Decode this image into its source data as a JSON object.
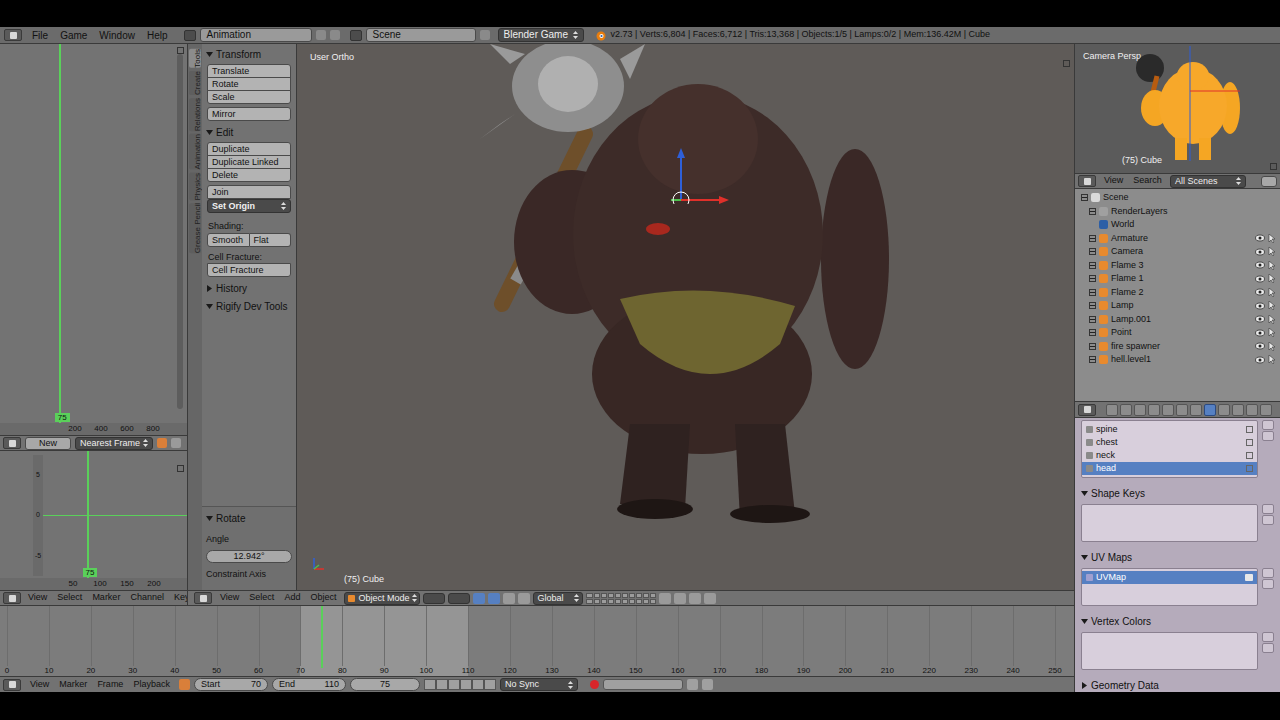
{
  "topbar": {
    "menus": [
      "File",
      "Game",
      "Window",
      "Help"
    ],
    "layout": "Animation",
    "scene": "Scene",
    "engine": "Blender Game",
    "stats": "v2.73 | Verts:6,804 | Faces:6,712 | Tris:13,368 | Objects:1/5 | Lamps:0/2 | Mem:136.42M | Cube"
  },
  "dopesheet_graph": {
    "frame": "75",
    "ticks": [
      "200",
      "400",
      "600",
      "800"
    ]
  },
  "graph_header": {
    "new_button": "New",
    "interpolation": "Nearest Frame"
  },
  "curve_graph": {
    "frame": "75",
    "ticks": [
      "50",
      "100",
      "150",
      "200"
    ],
    "value_ticks": [
      "5",
      "0",
      "-5"
    ]
  },
  "curve_header": {
    "menus": [
      "View",
      "Select",
      "Marker",
      "Channel",
      "Key"
    ]
  },
  "tool_tabs": [
    {
      "label": "Tools",
      "selected": true
    },
    {
      "label": "Create",
      "selected": false
    },
    {
      "label": "Relations",
      "selected": false
    },
    {
      "label": "Animation",
      "selected": false
    },
    {
      "label": "Physics",
      "selected": false
    },
    {
      "label": "Grease Pencil",
      "selected": false
    }
  ],
  "tool_panels": [
    {
      "title": "Transform",
      "expanded": true,
      "groups": [
        [
          {
            "kind": "button",
            "label": "Translate"
          },
          {
            "kind": "button",
            "label": "Rotate"
          },
          {
            "kind": "button",
            "label": "Scale"
          }
        ],
        [
          {
            "kind": "button",
            "label": "Mirror"
          }
        ]
      ]
    },
    {
      "title": "Edit",
      "expanded": true,
      "groups": [
        [
          {
            "kind": "button",
            "label": "Duplicate"
          },
          {
            "kind": "button",
            "label": "Duplicate Linked"
          },
          {
            "kind": "button",
            "label": "Delete"
          }
        ],
        [
          {
            "kind": "button",
            "label": "Join"
          },
          {
            "kind": "menu",
            "label": "Set Origin"
          }
        ],
        [
          {
            "kind": "label",
            "label": "Shading:"
          },
          {
            "kind": "pair",
            "labels": [
              "Smooth",
              "Flat"
            ]
          },
          {
            "kind": "label",
            "label": "Cell Fracture:"
          },
          {
            "kind": "button",
            "label": "Cell Fracture"
          }
        ]
      ]
    },
    {
      "title": "History",
      "expanded": false,
      "groups": []
    },
    {
      "title": "Rigify Dev Tools",
      "expanded": true,
      "groups": []
    }
  ],
  "operator_panel": {
    "title": "Rotate",
    "expanded": true,
    "angle_label": "Angle",
    "angle": "12.942°",
    "constraint_label": "Constraint Axis"
  },
  "viewport": {
    "view": "User Ortho",
    "object": "(75) Cube"
  },
  "viewport_header": {
    "menus": [
      "View",
      "Select",
      "Add",
      "Object"
    ],
    "mode": "Object Mode",
    "orientation": "Global"
  },
  "camera_view": {
    "view": "Camera Persp",
    "object": "(75) Cube"
  },
  "outliner": {
    "menus": [
      "View",
      "Search"
    ],
    "filter": "All Scenes",
    "root": {
      "label": "Scene",
      "kind": "scene",
      "expandable": true,
      "expanded": true
    },
    "items": [
      {
        "label": "RenderLayers",
        "kind": "renderlayers",
        "expandable": true,
        "expanded": false
      },
      {
        "label": "World",
        "kind": "world",
        "expandable": false,
        "expanded": false
      },
      {
        "label": "Armature",
        "kind": "armature",
        "expandable": true,
        "expanded": false
      },
      {
        "label": "Camera",
        "kind": "camera",
        "expandable": true,
        "expanded": false
      },
      {
        "label": "Flame 3",
        "kind": "mesh",
        "expandable": true,
        "expanded": false
      },
      {
        "label": "Flame 1",
        "kind": "mesh",
        "expandable": true,
        "expanded": false
      },
      {
        "label": "Flame 2",
        "kind": "mesh",
        "expandable": true,
        "expanded": false
      },
      {
        "label": "Lamp",
        "kind": "lamp",
        "expandable": true,
        "expanded": false
      },
      {
        "label": "Lamp.001",
        "kind": "lamp",
        "expandable": true,
        "expanded": false
      },
      {
        "label": "Point",
        "kind": "lamp",
        "expandable": true,
        "expanded": false
      },
      {
        "label": "fire spawner",
        "kind": "empty",
        "expandable": true,
        "expanded": false
      },
      {
        "label": "hell.level1",
        "kind": "mesh",
        "expandable": true,
        "expanded": false
      }
    ]
  },
  "properties": {
    "tabs": [
      {
        "selected": false
      },
      {
        "selected": false
      },
      {
        "selected": false
      },
      {
        "selected": false
      },
      {
        "selected": false
      },
      {
        "selected": false
      },
      {
        "selected": false
      },
      {
        "selected": true
      },
      {
        "selected": false
      },
      {
        "selected": false
      },
      {
        "selected": false
      },
      {
        "selected": false
      }
    ],
    "vertex_groups": [
      {
        "label": "spine",
        "selected": false
      },
      {
        "label": "chest",
        "selected": false
      },
      {
        "label": "neck",
        "selected": false
      },
      {
        "label": "head",
        "selected": true
      }
    ],
    "panels": [
      {
        "title": "Shape Keys",
        "expanded": true,
        "items": []
      },
      {
        "title": "UV Maps",
        "expanded": true,
        "items": [
          {
            "label": "UVMap",
            "selected": true
          }
        ]
      },
      {
        "title": "Vertex Colors",
        "expanded": true,
        "items": []
      },
      {
        "title": "Geometry Data",
        "expanded": false,
        "items": []
      }
    ]
  },
  "timeline": {
    "ticks": [
      "0",
      "10",
      "20",
      "30",
      "40",
      "50",
      "60",
      "70",
      "80",
      "90",
      "100",
      "110",
      "120",
      "130",
      "140",
      "150",
      "160",
      "170",
      "180",
      "190",
      "200",
      "210",
      "220",
      "230",
      "240",
      "250"
    ],
    "current": "75",
    "start_label": "Start",
    "start": "70",
    "end_label": "End",
    "end": "110",
    "sync": "No Sync",
    "menus": [
      "View",
      "Marker",
      "Frame",
      "Playback"
    ]
  }
}
